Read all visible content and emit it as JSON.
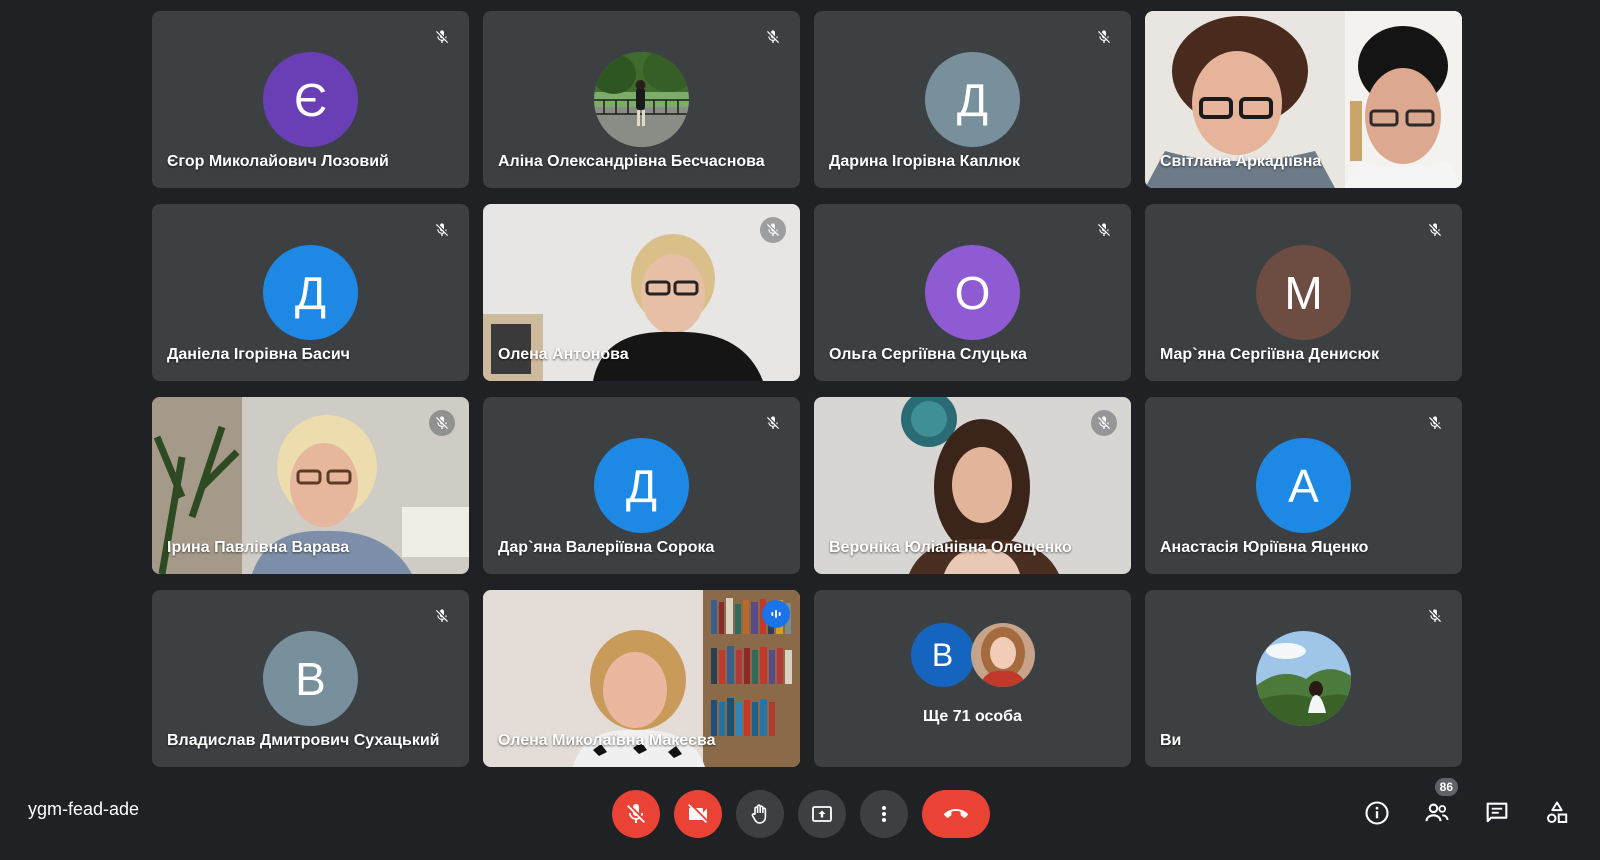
{
  "meeting": {
    "code": "ygm-fead-ade"
  },
  "participants": [
    {
      "name": "Єгор Миколайович Лозовий",
      "initial": "Є",
      "color": "#6a3fb5",
      "type": "avatar",
      "muted": true
    },
    {
      "name": "Аліна Олександрівна Бесчаснова",
      "type": "photo-avatar",
      "muted": true
    },
    {
      "name": "Дарина Ігорівна Каплюк",
      "initial": "Д",
      "color": "#78909c",
      "type": "avatar",
      "muted": true
    },
    {
      "name": "Світлана Аркадіївна",
      "type": "video",
      "muted": false
    },
    {
      "name": "Даніела Ігорівна Басич",
      "initial": "Д",
      "color": "#1e88e5",
      "type": "avatar",
      "muted": true
    },
    {
      "name": "Олена Антонова",
      "type": "video",
      "muted": true
    },
    {
      "name": "Ольга Сергіївна Слуцька",
      "initial": "О",
      "color": "#8e5bd3",
      "type": "avatar",
      "muted": true
    },
    {
      "name": "Мар`яна Сергіївна Денисюк",
      "initial": "М",
      "color": "#6d4c41",
      "type": "avatar",
      "muted": true
    },
    {
      "name": "Ірина Павлівна Варава",
      "type": "video",
      "muted": true
    },
    {
      "name": "Дар`яна Валеріївна Сорока",
      "initial": "Д",
      "color": "#1e88e5",
      "type": "avatar",
      "muted": true
    },
    {
      "name": "Вероніка Юліанівна Олещенко",
      "type": "video",
      "muted": true
    },
    {
      "name": "Анастасія Юріївна Яценко",
      "initial": "А",
      "color": "#1e88e5",
      "type": "avatar",
      "muted": true
    },
    {
      "name": "Владислав Дмитрович Сухацький",
      "initial": "В",
      "color": "#78909c",
      "type": "avatar",
      "muted": true
    },
    {
      "name": "Олена Миколаївна Макеєва",
      "type": "video",
      "speaking": true
    },
    {
      "more_label": "Ще 71 особа",
      "initial": "В",
      "color": "#1565c0",
      "type": "more"
    },
    {
      "name": "Ви",
      "type": "photo-avatar",
      "muted": true
    }
  ],
  "participants_count": "86",
  "colors": {
    "background": "#202124",
    "tile": "#3c4043",
    "danger": "#ea4335",
    "active_outline": "#8ab4f8",
    "speaking": "#1a73e8"
  },
  "icons": {
    "mic_muted": "mic-off-icon",
    "camera_off": "videocam-off-icon",
    "raise_hand": "hand-icon",
    "present": "present-screen-icon",
    "more": "more-vert-icon",
    "hangup": "call-end-icon",
    "info": "info-icon",
    "people": "people-icon",
    "chat": "chat-icon",
    "activities": "activities-icon"
  }
}
